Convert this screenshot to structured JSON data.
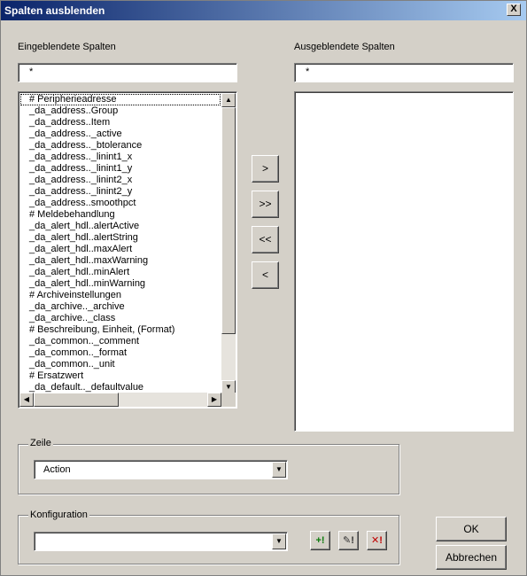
{
  "window": {
    "title": "Spalten ausblenden",
    "close_label": "X"
  },
  "visible_columns": {
    "label": "Eingeblendete Spalten",
    "filter_value": "*",
    "items": [
      "# Peripherieadresse",
      "_da_address..Group",
      "_da_address..Item",
      "_da_address.._active",
      "_da_address.._btolerance",
      "_da_address.._linint1_x",
      "_da_address.._linint1_y",
      "_da_address.._linint2_x",
      "_da_address.._linint2_y",
      "_da_address..smoothpct",
      "# Meldebehandlung",
      "_da_alert_hdl..alertActive",
      "_da_alert_hdl..alertString",
      "_da_alert_hdl..maxAlert",
      "_da_alert_hdl..maxWarning",
      "_da_alert_hdl..minAlert",
      "_da_alert_hdl..minWarning",
      "# Archiveinstellungen",
      "_da_archive.._archive",
      "_da_archive.._class",
      "# Beschreibung, Einheit, (Format)",
      "_da_common.._comment",
      "_da_common.._format",
      "_da_common.._unit",
      "# Ersatzwert",
      "_da_default.._defaultvalue"
    ]
  },
  "hidden_columns": {
    "label": "Ausgeblendete Spalten",
    "filter_value": "*",
    "items": []
  },
  "move_buttons": {
    "move_one_right": ">",
    "move_all_right": ">>",
    "move_all_left": "<<",
    "move_one_left": "<"
  },
  "row_group": {
    "title": "Zeile",
    "selected": "Action"
  },
  "config_group": {
    "title": "Konfiguration",
    "selected": "",
    "add_label": "+!",
    "edit_label": "✎!",
    "delete_label": "✕!"
  },
  "dialog_buttons": {
    "ok": "OK",
    "cancel": "Abbrechen"
  },
  "colors": {
    "title_start": "#0a246a",
    "title_end": "#a6caf0",
    "dialog_bg": "#d4d0c8",
    "add_icon": "#0a7a0a",
    "delete_icon": "#c00000"
  },
  "icons": {
    "scroll_up": "▲",
    "scroll_down": "▼",
    "scroll_left": "◀",
    "scroll_right": "▶",
    "dropdown": "▼"
  }
}
